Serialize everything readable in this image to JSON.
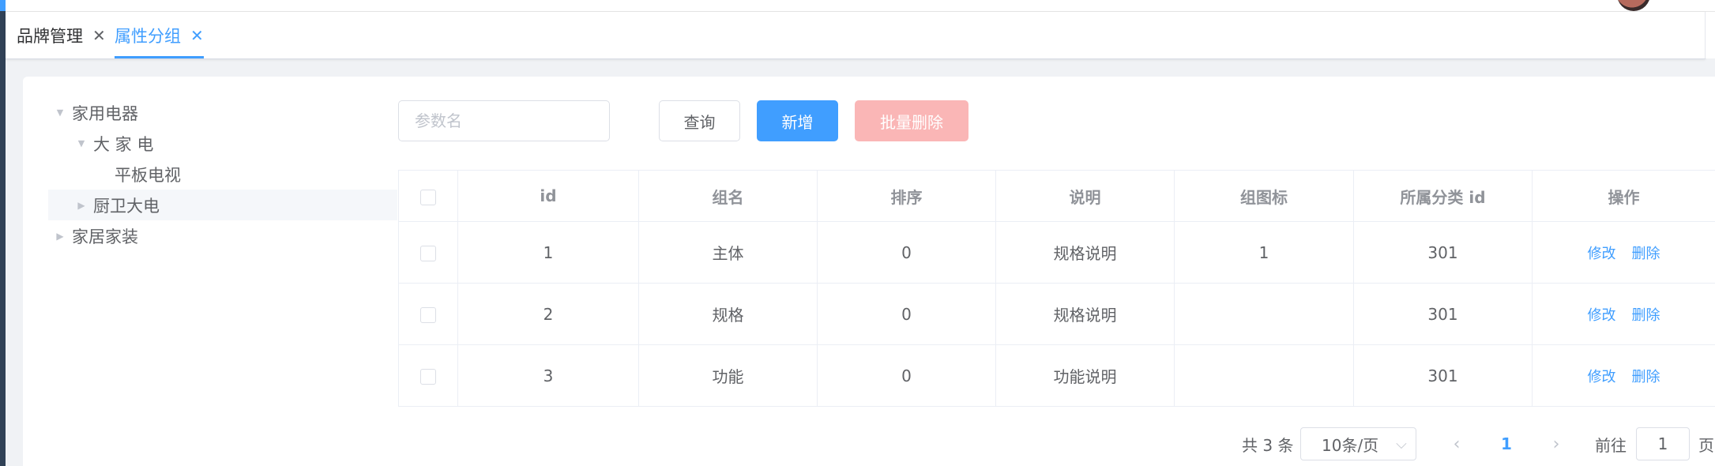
{
  "tabs": [
    {
      "label": "品牌管理",
      "close": "✕",
      "active": false
    },
    {
      "label": "属性分组",
      "close": "✕",
      "active": true
    }
  ],
  "tree": [
    {
      "label": "家用电器",
      "caret": "▼",
      "level": 0
    },
    {
      "label": "大 家 电",
      "caret": "▼",
      "level": 1
    },
    {
      "label": "平板电视",
      "caret": "",
      "level": 2
    },
    {
      "label": "厨卫大电",
      "caret": "▶",
      "level": 1
    },
    {
      "label": "家居家装",
      "caret": "▶",
      "level": 0
    }
  ],
  "search": {
    "placeholder": "参数名",
    "value": ""
  },
  "buttons": {
    "query": "查询",
    "add": "新增",
    "batch_delete": "批量删除"
  },
  "table": {
    "columns": [
      "id",
      "组名",
      "排序",
      "说明",
      "组图标",
      "所属分类 id",
      "操作"
    ],
    "rows": [
      {
        "id": "1",
        "name": "主体",
        "sort": "0",
        "desc": "规格说明",
        "icon": "1",
        "catalog_id": "301"
      },
      {
        "id": "2",
        "name": "规格",
        "sort": "0",
        "desc": "规格说明",
        "icon": "",
        "catalog_id": "301"
      },
      {
        "id": "3",
        "name": "功能",
        "sort": "0",
        "desc": "功能说明",
        "icon": "",
        "catalog_id": "301"
      }
    ],
    "actions": {
      "edit": "修改",
      "delete": "删除"
    }
  },
  "pagination": {
    "total": "共 3 条",
    "page_size": "10条/页",
    "prev": "‹",
    "current_page": "1",
    "next": "›",
    "goto_label": "前往",
    "goto_value": "1",
    "goto_unit": "页"
  },
  "colors": {
    "primary": "#409eff",
    "danger_disabled": "#fab6b6",
    "sidebar": "#304156"
  }
}
